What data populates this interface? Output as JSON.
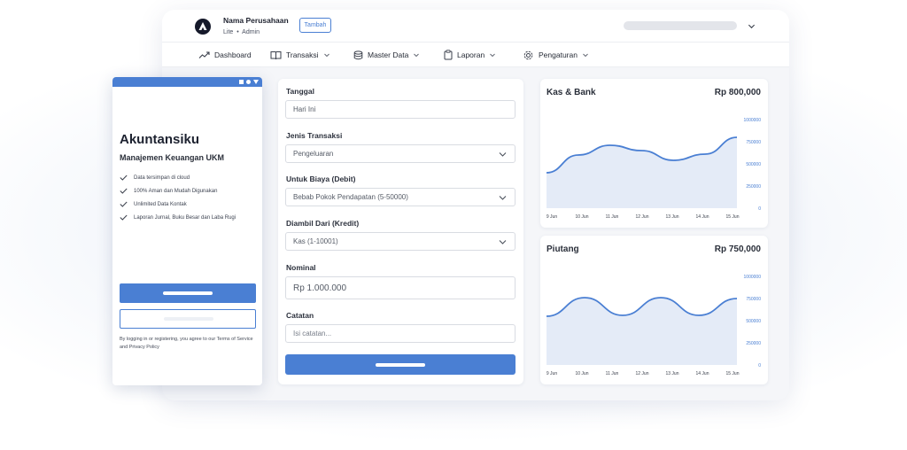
{
  "header": {
    "company_name": "Nama Perusahaan",
    "plan": "Lite",
    "role": "Admin",
    "add_button_label": "Tambah",
    "logo_icon": "company-logo-icon",
    "user_menu_icon": "chevron-down-icon"
  },
  "nav": {
    "items": [
      {
        "label": "Dashboard",
        "icon": "trending-up-icon"
      },
      {
        "label": "Transaksi",
        "icon": "book-icon"
      },
      {
        "label": "Master Data",
        "icon": "database-icon"
      },
      {
        "label": "Laporan",
        "icon": "clipboard-icon"
      },
      {
        "label": "Pengaturan",
        "icon": "gear-icon"
      }
    ]
  },
  "form": {
    "tanggal": {
      "label": "Tanggal",
      "value": "Hari Ini"
    },
    "jenis": {
      "label": "Jenis Transaksi",
      "value": "Pengeluaran"
    },
    "debit": {
      "label": "Untuk Biaya (Debit)",
      "value": "Bebab Pokok Pendapatan (5-50000)"
    },
    "kredit": {
      "label": "Diambil Dari (Kredit)",
      "value": "Kas (1-10001)"
    },
    "nominal": {
      "label": "Nominal",
      "value": "Rp 1.000.000"
    },
    "catatan": {
      "label": "Catatan",
      "placeholder": "Isi catatan..."
    }
  },
  "charts": [
    {
      "title": "Kas  & Bank",
      "total": "Rp 800,000",
      "type": "area",
      "x": [
        "9 Jun",
        "10 Jun",
        "11 Jun",
        "12 Jun",
        "13 Jun",
        "14 Jun",
        "15 Jun"
      ],
      "y_ticks": [
        "1000000",
        "750000",
        "500000",
        "250000",
        "0"
      ],
      "ylim": [
        0,
        1000000
      ],
      "values": [
        400000,
        600000,
        710000,
        650000,
        540000,
        610000,
        800000
      ],
      "line_color": "#4a7fd3"
    },
    {
      "title": "Piutang",
      "total": "Rp 750,000",
      "type": "area",
      "x": [
        "9 Jun",
        "10 Jun",
        "11 Jun",
        "12 Jun",
        "13 Jun",
        "14 Jun",
        "15 Jun"
      ],
      "y_ticks": [
        "1000000",
        "750000",
        "500000",
        "250000",
        "0"
      ],
      "ylim": [
        0,
        1000000
      ],
      "values": [
        550000,
        760000,
        560000,
        760000,
        560000,
        750000
      ],
      "line_color": "#4a7fd3"
    }
  ],
  "login": {
    "brand": "Akuntansiku",
    "tagline": "Manajemen Keuangan UKM",
    "features": [
      "Data tersimpan di cloud",
      "100% Aman dan Mudah Digunakan",
      "Unlimited Data Kontak",
      "Laporan Jurnal, Buku Besar dan Laba Rugi"
    ],
    "terms": "By logging in or registering, you agree to our Terms of Service and Privacy Policy"
  },
  "colors": {
    "accent": "#4a7fd3",
    "area_fill": "#e4ebf7",
    "background": "#f5f6f9"
  }
}
